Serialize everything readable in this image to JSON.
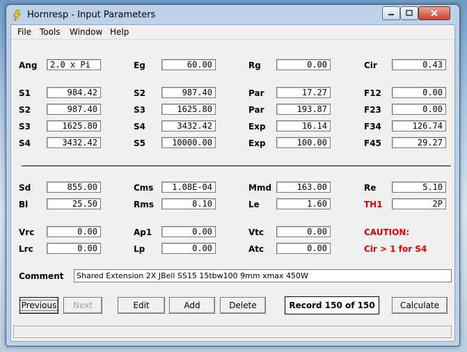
{
  "window": {
    "title": "Hornresp - Input Parameters"
  },
  "menu": [
    "File",
    "Tools",
    "Window",
    "Help"
  ],
  "row1": {
    "ang_label": "Ang",
    "ang": "2.0 x Pi",
    "eg_label": "Eg",
    "eg": "60.00",
    "rg_label": "Rg",
    "rg": "0.00",
    "cir_label": "Cir",
    "cir": "0.43"
  },
  "horn": [
    {
      "l1": "S1",
      "v1": "984.42",
      "l2": "S2",
      "v2": "987.40",
      "l3": "Par",
      "v3": "17.27",
      "l4": "F12",
      "v4": "0.00"
    },
    {
      "l1": "S2",
      "v1": "987.40",
      "l2": "S3",
      "v2": "1625.80",
      "l3": "Par",
      "v3": "193.87",
      "l4": "F23",
      "v4": "0.00"
    },
    {
      "l1": "S3",
      "v1": "1625.80",
      "l2": "S4",
      "v2": "3432.42",
      "l3": "Exp",
      "v3": "16.14",
      "l4": "F34",
      "v4": "126.74"
    },
    {
      "l1": "S4",
      "v1": "3432.42",
      "l2": "S5",
      "v2": "10000.00",
      "l3": "Exp",
      "v3": "100.00",
      "l4": "F45",
      "v4": "29.27"
    }
  ],
  "driver": {
    "sd_label": "Sd",
    "sd": "855.00",
    "cms_label": "Cms",
    "cms": "1.08E-04",
    "mmd_label": "Mmd",
    "mmd": "163.00",
    "re_label": "Re",
    "re": "5.10",
    "bl_label": "Bl",
    "bl": "25.50",
    "rms_label": "Rms",
    "rms": "8.10",
    "le_label": "Le",
    "le": "1.60",
    "th1_label": "TH1",
    "th1": "2P"
  },
  "chambers": {
    "vrc_label": "Vrc",
    "vrc": "0.00",
    "ap1_label": "Ap1",
    "ap1": "0.00",
    "vtc_label": "Vtc",
    "vtc": "0.00",
    "caution": "CAUTION:",
    "lrc_label": "Lrc",
    "lrc": "0.00",
    "lp_label": "Lp",
    "lp": "0.00",
    "atc_label": "Atc",
    "atc": "0.00",
    "caution_msg": "Cir > 1 for S4"
  },
  "comment": {
    "label": "Comment",
    "value": "Shared Extension 2X JBell SS15 15tbw100 9mm xmax 450W"
  },
  "buttons": {
    "previous": "Previous",
    "next": "Next",
    "edit": "Edit",
    "add": "Add",
    "delete": "Delete",
    "calculate": "Calculate"
  },
  "record": "Record 150 of 150",
  "colors": {
    "caution": "#e00000"
  }
}
